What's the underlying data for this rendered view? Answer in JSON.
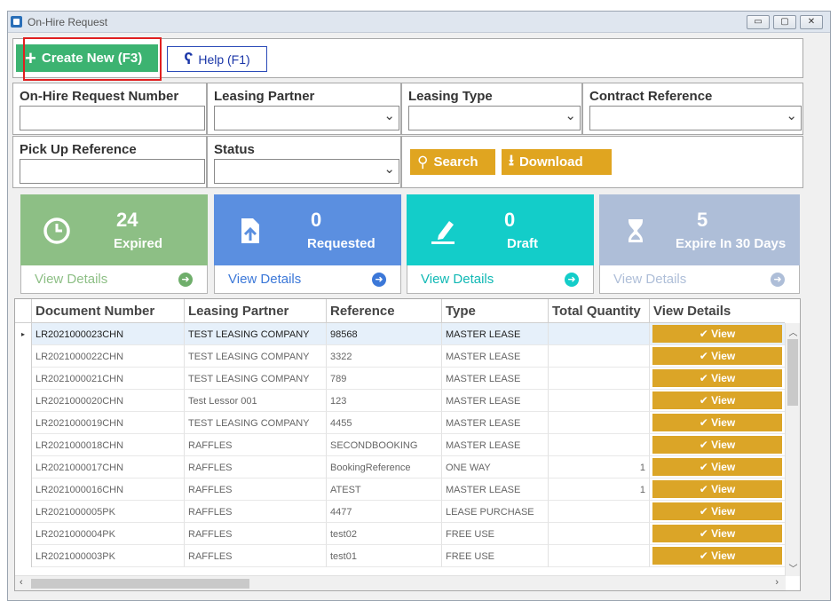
{
  "window": {
    "title": "On-Hire Request"
  },
  "toolbar": {
    "create_label": "Create New (F3)",
    "help_label": "Help (F1)"
  },
  "filters": {
    "on_hire_request_number": {
      "label": "On-Hire Request Number",
      "value": ""
    },
    "leasing_partner": {
      "label": "Leasing Partner",
      "value": ""
    },
    "leasing_type": {
      "label": "Leasing Type",
      "value": ""
    },
    "contract_reference": {
      "label": "Contract Reference",
      "value": ""
    },
    "pick_up_reference": {
      "label": "Pick Up Reference",
      "value": ""
    },
    "status": {
      "label": "Status",
      "value": ""
    },
    "search_label": "Search",
    "download_label": "Download"
  },
  "cards": [
    {
      "count": "24",
      "label": "Expired",
      "view": "View Details",
      "color": "#8dbf85",
      "icon": "clock-icon"
    },
    {
      "count": "0",
      "label": "Requested",
      "view": "View Details",
      "color": "#5b8fe0",
      "icon": "upload-file-icon"
    },
    {
      "count": "0",
      "label": "Draft",
      "view": "View Details",
      "color": "#13cdc9",
      "icon": "pen-icon"
    },
    {
      "count": "5",
      "label": "Expire In 30 Days",
      "view": "View Details",
      "color": "#aebed8",
      "icon": "hourglass-icon"
    }
  ],
  "grid": {
    "columns": [
      "Document Number",
      "Leasing Partner",
      "Reference",
      "Type",
      "Total Quantity",
      "View Details"
    ],
    "view_label": "View",
    "rows": [
      {
        "doc": "LR2021000023CHN",
        "partner": "TEST LEASING COMPANY",
        "ref": "98568",
        "type": "MASTER LEASE",
        "qty": ""
      },
      {
        "doc": "LR2021000022CHN",
        "partner": "TEST LEASING COMPANY",
        "ref": "3322",
        "type": "MASTER LEASE",
        "qty": ""
      },
      {
        "doc": "LR2021000021CHN",
        "partner": "TEST LEASING COMPANY",
        "ref": "789",
        "type": "MASTER LEASE",
        "qty": ""
      },
      {
        "doc": "LR2021000020CHN",
        "partner": "Test Lessor 001",
        "ref": "123",
        "type": "MASTER LEASE",
        "qty": ""
      },
      {
        "doc": "LR2021000019CHN",
        "partner": "TEST LEASING COMPANY",
        "ref": "4455",
        "type": "MASTER LEASE",
        "qty": ""
      },
      {
        "doc": "LR2021000018CHN",
        "partner": "RAFFLES",
        "ref": "SECONDBOOKING",
        "type": "MASTER LEASE",
        "qty": ""
      },
      {
        "doc": "LR2021000017CHN",
        "partner": "RAFFLES",
        "ref": "BookingReference",
        "type": "ONE WAY",
        "qty": "1"
      },
      {
        "doc": "LR2021000016CHN",
        "partner": "RAFFLES",
        "ref": "ATEST",
        "type": "MASTER LEASE",
        "qty": "1"
      },
      {
        "doc": "LR2021000005PK",
        "partner": "RAFFLES",
        "ref": "4477",
        "type": "LEASE PURCHASE",
        "qty": ""
      },
      {
        "doc": "LR2021000004PK",
        "partner": "RAFFLES",
        "ref": "test02",
        "type": "FREE USE",
        "qty": ""
      },
      {
        "doc": "LR2021000003PK",
        "partner": "RAFFLES",
        "ref": "test01",
        "type": "FREE USE",
        "qty": ""
      }
    ]
  }
}
